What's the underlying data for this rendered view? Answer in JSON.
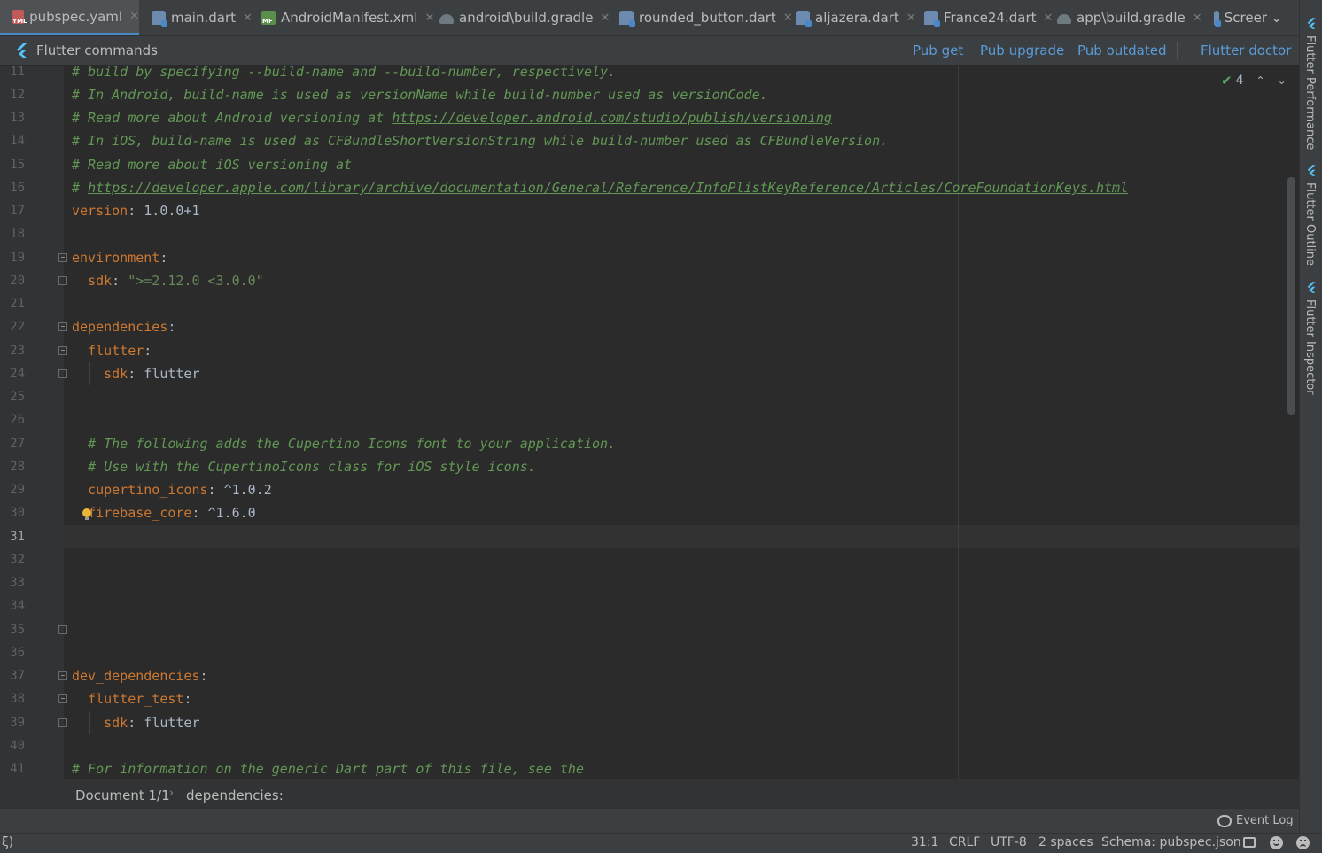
{
  "tabs": [
    {
      "label": "pubspec.yaml",
      "icon": "yaml-file-icon",
      "active": true
    },
    {
      "label": "main.dart",
      "icon": "dart-file-icon"
    },
    {
      "label": "AndroidManifest.xml",
      "icon": "xml-file-icon"
    },
    {
      "label": "android\\build.gradle",
      "icon": "gradle-file-icon"
    },
    {
      "label": "rounded_button.dart",
      "icon": "dart-file-icon"
    },
    {
      "label": "aljazera.dart",
      "icon": "dart-file-icon"
    },
    {
      "label": "France24.dart",
      "icon": "dart-file-icon"
    },
    {
      "label": "app\\build.gradle",
      "icon": "gradle-file-icon"
    },
    {
      "label": "Screer",
      "icon": "dart-file-icon"
    }
  ],
  "flutter_bar": {
    "title": "Flutter commands",
    "pub_get": "Pub get",
    "pub_upgrade": "Pub upgrade",
    "pub_outdated": "Pub outdated",
    "flutter_doctor": "Flutter doctor"
  },
  "inspections": {
    "count": "4"
  },
  "line_numbers": [
    "11",
    "12",
    "13",
    "14",
    "15",
    "16",
    "17",
    "18",
    "19",
    "20",
    "21",
    "22",
    "23",
    "24",
    "25",
    "26",
    "27",
    "28",
    "29",
    "30",
    "31",
    "32",
    "33",
    "34",
    "35",
    "36",
    "37",
    "38",
    "39",
    "40",
    "41"
  ],
  "code": {
    "l11": "# build by specifying --build-name and --build-number, respectively.",
    "l12": "# In Android, build-name is used as versionName while build-number used as versionCode.",
    "l13_text": "# Read more about Android versioning at ",
    "l13_link": "https://developer.android.com/studio/publish/versioning",
    "l14": "# In iOS, build-name is used as CFBundleShortVersionString while build-number used as CFBundleVersion.",
    "l15": "# Read more about iOS versioning at",
    "l16_text": "# ",
    "l16_link": "https://developer.apple.com/library/archive/documentation/General/Reference/InfoPlistKeyReference/Articles/CoreFoundationKeys.html",
    "l17_key": "version",
    "l17_val": " 1.0.0+1",
    "l19_key": "environment",
    "l20_key": "sdk",
    "l20_val": "\">=2.12.0 <3.0.0\"",
    "l22_key": "dependencies",
    "l23_key": "flutter",
    "l24_key": "sdk",
    "l24_val": " flutter",
    "l27": "# The following adds the Cupertino Icons font to your application.",
    "l28": "# Use with the CupertinoIcons class for iOS style icons.",
    "l29_key": "cupertino_icons",
    "l29_val": " ^1.0.2",
    "l30_key": "firebase_core",
    "l30_val": " ^1.6.0",
    "l37_key": "dev_dependencies",
    "l38_key": "flutter_test",
    "l39_key": "sdk",
    "l39_val": " flutter",
    "l41": "# For information on the generic Dart part of this file, see the"
  },
  "breadcrumb": {
    "document": "Document 1/1",
    "path": "dependencies:"
  },
  "event_log": "Event Log",
  "status": {
    "left": "ξ)",
    "position": "31:1",
    "line_sep": "CRLF",
    "encoding": "UTF-8",
    "indent": "2 spaces",
    "schema": "Schema: pubspec.json"
  },
  "right_tools": [
    "Flutter Performance",
    "Flutter Outline",
    "Flutter Inspector"
  ]
}
